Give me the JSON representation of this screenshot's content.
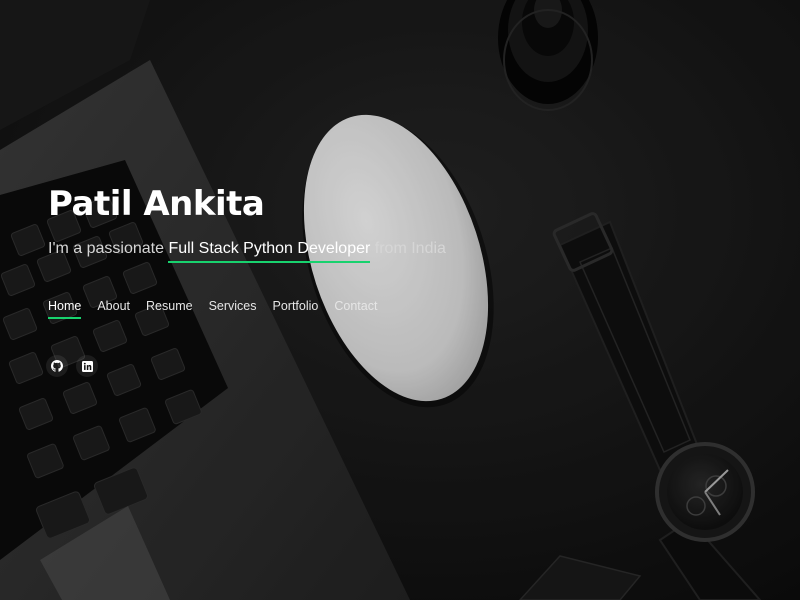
{
  "hero": {
    "name": "Patil Ankita",
    "tagline_prefix": "I'm a passionate ",
    "tagline_role": "Full Stack Python Developer",
    "tagline_suffix": " from India"
  },
  "nav": {
    "items": [
      {
        "label": "Home",
        "active": true
      },
      {
        "label": "About",
        "active": false
      },
      {
        "label": "Resume",
        "active": false
      },
      {
        "label": "Services",
        "active": false
      },
      {
        "label": "Portfolio",
        "active": false
      },
      {
        "label": "Contact",
        "active": false
      }
    ]
  },
  "social": [
    {
      "icon": "github-icon"
    },
    {
      "icon": "linkedin-icon"
    }
  ],
  "colors": {
    "accent": "#18d26e",
    "background": "#0d0d0d",
    "text": "#ffffff"
  },
  "background_image": {
    "subjects": [
      "laptop-keyboard",
      "white-mouse",
      "wristwatch",
      "camera-lens"
    ]
  }
}
